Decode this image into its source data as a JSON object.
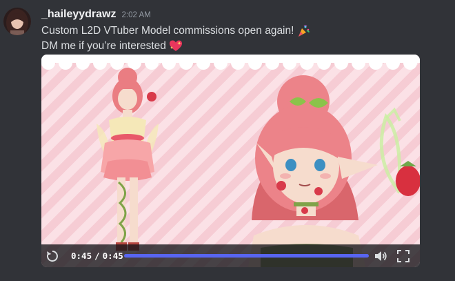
{
  "message": {
    "username": "_haileyydrawz",
    "timestamp": "2:02 AM",
    "line1": "Custom L2D VTuber Model commissions open again!",
    "line1_emoji": "party-popper-icon",
    "line2": "DM me if you’re interested",
    "line2_emoji": "sparkling-heart-icon"
  },
  "video": {
    "current_time": "0:45",
    "separator": "/",
    "duration": "0:45",
    "progress_fraction": 1.0,
    "controls": [
      "replay-icon",
      "volume-icon",
      "fullscreen-icon"
    ]
  },
  "colors": {
    "background": "#313338",
    "accent": "#5865f2",
    "username": "#f2f3f5",
    "timestamp": "#949ba4"
  }
}
